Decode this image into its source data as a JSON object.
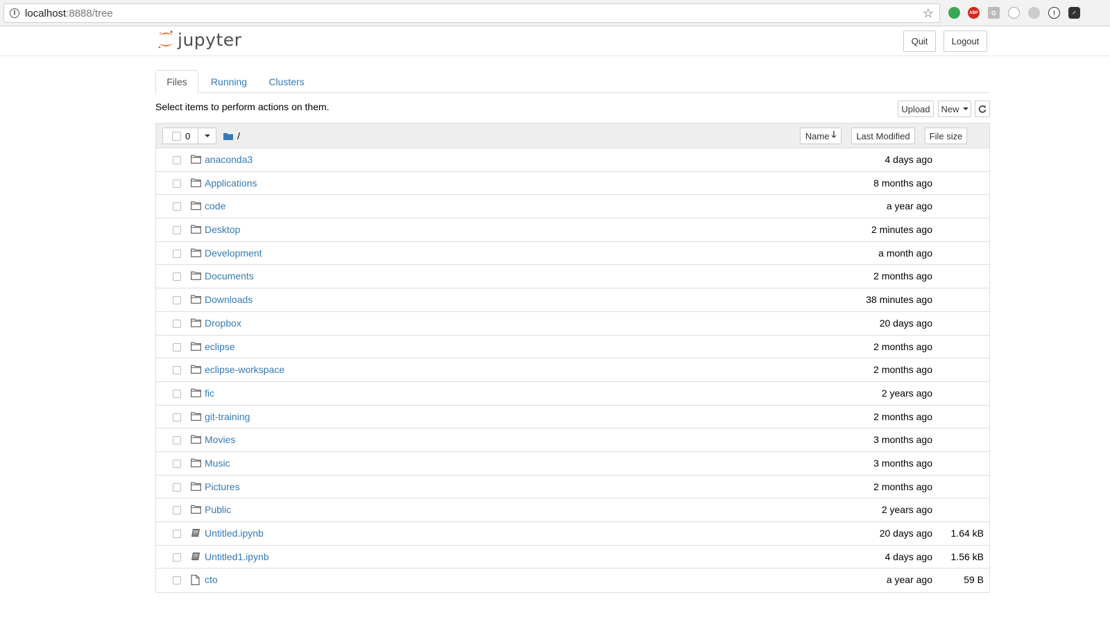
{
  "browser": {
    "url_host": "localhost",
    "url_rest": ":8888/tree"
  },
  "header": {
    "logo_text": "jupyter",
    "quit_label": "Quit",
    "logout_label": "Logout"
  },
  "tabs": [
    {
      "label": "Files",
      "active": true
    },
    {
      "label": "Running",
      "active": false
    },
    {
      "label": "Clusters",
      "active": false
    }
  ],
  "toolbar": {
    "hint": "Select items to perform actions on them.",
    "upload_label": "Upload",
    "new_label": "New"
  },
  "list_header": {
    "selected_count": "0",
    "path": "/",
    "sort_name_label": "Name",
    "sort_modified_label": "Last Modified",
    "sort_size_label": "File size"
  },
  "files": [
    {
      "name": "anaconda3",
      "type": "folder",
      "modified": "4 days ago",
      "size": ""
    },
    {
      "name": "Applications",
      "type": "folder",
      "modified": "8 months ago",
      "size": ""
    },
    {
      "name": "code",
      "type": "folder",
      "modified": "a year ago",
      "size": ""
    },
    {
      "name": "Desktop",
      "type": "folder",
      "modified": "2 minutes ago",
      "size": ""
    },
    {
      "name": "Development",
      "type": "folder",
      "modified": "a month ago",
      "size": ""
    },
    {
      "name": "Documents",
      "type": "folder",
      "modified": "2 months ago",
      "size": ""
    },
    {
      "name": "Downloads",
      "type": "folder",
      "modified": "38 minutes ago",
      "size": ""
    },
    {
      "name": "Dropbox",
      "type": "folder",
      "modified": "20 days ago",
      "size": ""
    },
    {
      "name": "eclipse",
      "type": "folder",
      "modified": "2 months ago",
      "size": ""
    },
    {
      "name": "eclipse-workspace",
      "type": "folder",
      "modified": "2 months ago",
      "size": ""
    },
    {
      "name": "fic",
      "type": "folder",
      "modified": "2 years ago",
      "size": ""
    },
    {
      "name": "git-training",
      "type": "folder",
      "modified": "2 months ago",
      "size": ""
    },
    {
      "name": "Movies",
      "type": "folder",
      "modified": "3 months ago",
      "size": ""
    },
    {
      "name": "Music",
      "type": "folder",
      "modified": "3 months ago",
      "size": ""
    },
    {
      "name": "Pictures",
      "type": "folder",
      "modified": "2 months ago",
      "size": ""
    },
    {
      "name": "Public",
      "type": "folder",
      "modified": "2 years ago",
      "size": ""
    },
    {
      "name": "Untitled.ipynb",
      "type": "notebook",
      "modified": "20 days ago",
      "size": "1.64 kB"
    },
    {
      "name": "Untitled1.ipynb",
      "type": "notebook",
      "modified": "4 days ago",
      "size": "1.56 kB"
    },
    {
      "name": "cto",
      "type": "file",
      "modified": "a year ago",
      "size": "59 B"
    }
  ],
  "colors": {
    "link": "#337ab7",
    "jupyter_orange": "#f37726"
  }
}
